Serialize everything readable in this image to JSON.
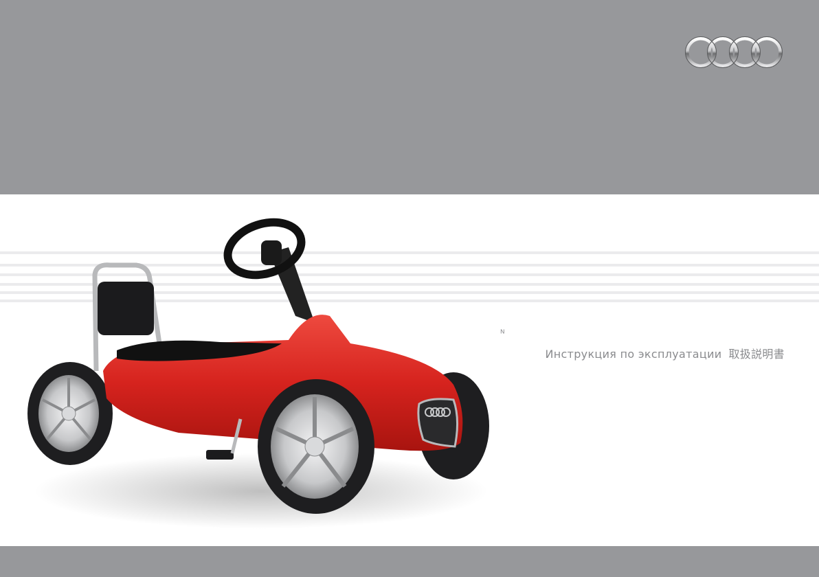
{
  "brand": {
    "logo_icon": "audi-four-rings-logo"
  },
  "colors": {
    "band_gray": "#97989b",
    "car_red": "#d6231e",
    "text_gray": "#8a8b8e"
  },
  "subtitle": {
    "russian": "Инструкция по эксплуатации",
    "japanese": "取扱説明書"
  },
  "artifact_glyph": "ᴺ",
  "photo": {
    "subject": "red-audi-pedal-car-icon"
  }
}
